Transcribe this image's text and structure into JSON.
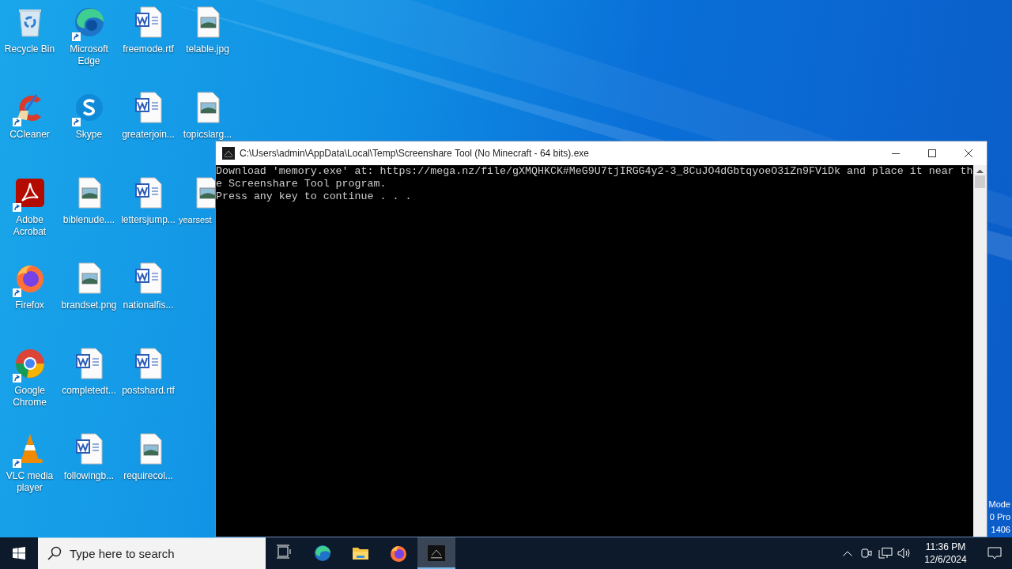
{
  "desktop_icons": [
    {
      "label": "Recycle Bin",
      "kind": "recycle-bin",
      "shortcut": false
    },
    {
      "label": "CCleaner",
      "kind": "ccleaner",
      "shortcut": true
    },
    {
      "label": "Adobe Acrobat",
      "kind": "acrobat",
      "shortcut": true
    },
    {
      "label": "Firefox",
      "kind": "firefox",
      "shortcut": true
    },
    {
      "label": "Google Chrome",
      "kind": "chrome",
      "shortcut": true
    },
    {
      "label": "VLC media player",
      "kind": "vlc",
      "shortcut": true
    },
    {
      "label": "Microsoft Edge",
      "kind": "edge",
      "shortcut": true
    },
    {
      "label": "Skype",
      "kind": "skype",
      "shortcut": true
    },
    {
      "label": "biblenude....",
      "kind": "image-file",
      "shortcut": false
    },
    {
      "label": "brandset.png",
      "kind": "image-file",
      "shortcut": false
    },
    {
      "label": "completedt...",
      "kind": "word-file",
      "shortcut": false
    },
    {
      "label": "followingb...",
      "kind": "word-file",
      "shortcut": false
    },
    {
      "label": "freemode.rtf",
      "kind": "word-file",
      "shortcut": false
    },
    {
      "label": "greaterjoin...",
      "kind": "word-file",
      "shortcut": false
    },
    {
      "label": "lettersjump...",
      "kind": "word-file",
      "shortcut": false
    },
    {
      "label": "nationalfis...",
      "kind": "word-file",
      "shortcut": false
    },
    {
      "label": "postshard.rtf",
      "kind": "word-file",
      "shortcut": false
    },
    {
      "label": "requirecol...",
      "kind": "word-file-image",
      "shortcut": false
    },
    {
      "label": "telable.jpg",
      "kind": "image-file",
      "shortcut": false
    },
    {
      "label": "topicslarg...",
      "kind": "image-file",
      "shortcut": false
    },
    {
      "label": "yearsest",
      "kind": "image-file",
      "shortcut": false
    }
  ],
  "console_window": {
    "title": "C:\\Users\\admin\\AppData\\Local\\Temp\\Screenshare Tool (No Minecraft - 64 bits).exe",
    "lines": [
      "Download 'memory.exe' at: https://mega.nz/file/gXMQHKCK#MeG9U7tjIRGG4y2-3_8CuJO4dGbtqyoeO3iZn9FViDk and place it near th",
      "e Screenshare Tool program.",
      "Press any key to continue . . ."
    ]
  },
  "os_watermark": [
    "Mode",
    "0 Pro",
    "1406"
  ],
  "taskbar": {
    "search": {
      "placeholder": "Type here to search"
    },
    "apps": [
      {
        "kind": "task-view",
        "selected": false
      },
      {
        "kind": "edge",
        "selected": false
      },
      {
        "kind": "explorer",
        "selected": false
      },
      {
        "kind": "firefox",
        "selected": false
      },
      {
        "kind": "console",
        "selected": true
      }
    ],
    "clock": {
      "time": "11:36 PM",
      "date": "12/6/2024"
    }
  }
}
